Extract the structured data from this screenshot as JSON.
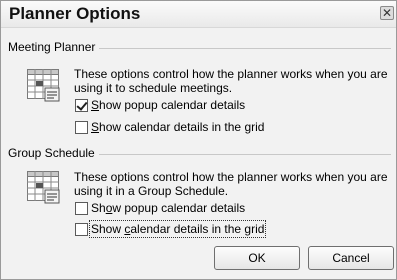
{
  "title": "Planner Options",
  "close_glyph": "✕",
  "meeting_planner": {
    "heading": "Meeting Planner",
    "description_line1": "These options control how the planner works when you are",
    "description_line2": "using it to schedule meetings.",
    "options": [
      {
        "label_key": "S",
        "label_rest": "how popup calendar details",
        "checked": true
      },
      {
        "label_key": "S",
        "label_rest": "how calendar details in the grid",
        "checked": false
      }
    ]
  },
  "group_schedule": {
    "heading": "Group Schedule",
    "description_line1": "These options control how the planner works when you are",
    "description_line2": "using it in a Group Schedule.",
    "options": [
      {
        "label_pre": "Sh",
        "label_key": "o",
        "label_rest": "w popup calendar details",
        "checked": false
      },
      {
        "label_pre": "Show ",
        "label_key": "c",
        "label_rest": "alendar details in the grid",
        "checked": false
      }
    ]
  },
  "buttons": {
    "ok": "OK",
    "cancel": "Cancel"
  }
}
